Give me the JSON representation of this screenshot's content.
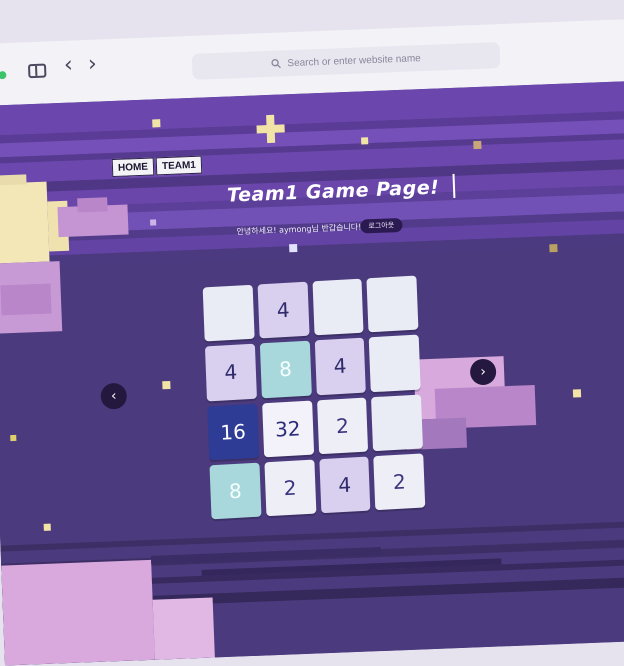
{
  "browser": {
    "search_placeholder": "Search or enter website name",
    "back_icon": "chevron-left-icon",
    "forward_icon": "chevron-right-icon",
    "sidebar_icon": "sidebar-icon"
  },
  "nav": {
    "home": "HOME",
    "team": "TEAM1"
  },
  "header": {
    "title": "Team1 Game Page!",
    "welcome": "안녕하세요! aymong님 반갑습니다!",
    "logout": "로그아웃"
  },
  "board": {
    "tiles": [
      [
        "",
        "4",
        "",
        ""
      ],
      [
        "4",
        "8",
        "4",
        ""
      ],
      [
        "16",
        "32",
        "2",
        ""
      ],
      [
        "8",
        "2",
        "4",
        "2"
      ]
    ]
  },
  "controls": {
    "prev": "‹",
    "next": "›"
  },
  "colors": {
    "page_background": "#4e3c86",
    "band_light": "#6b49ad",
    "band_dark": "#3e2e6b",
    "tile_16": "#2f3c95",
    "tile_8": "#a9d8dc"
  }
}
